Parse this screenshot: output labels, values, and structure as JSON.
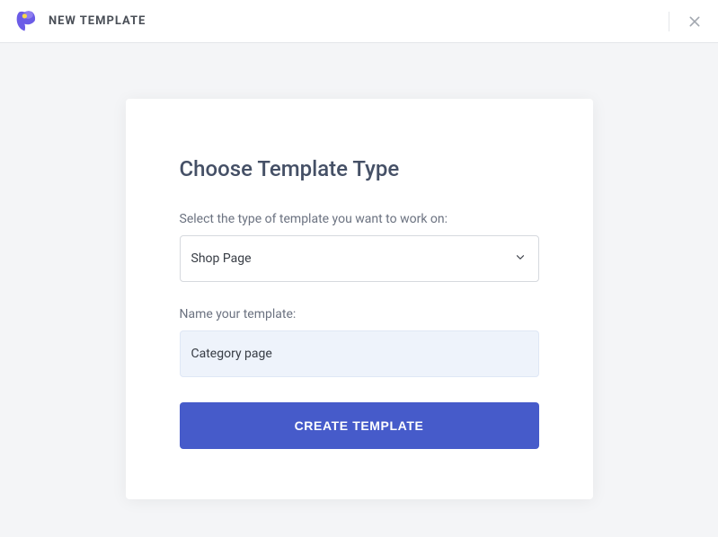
{
  "header": {
    "title": "NEW TEMPLATE"
  },
  "modal": {
    "title": "Choose Template Type",
    "type_label": "Select the type of template you want to work on:",
    "type_value": "Shop Page",
    "name_label": "Name your template:",
    "name_value": "Category page",
    "submit_label": "CREATE TEMPLATE"
  }
}
